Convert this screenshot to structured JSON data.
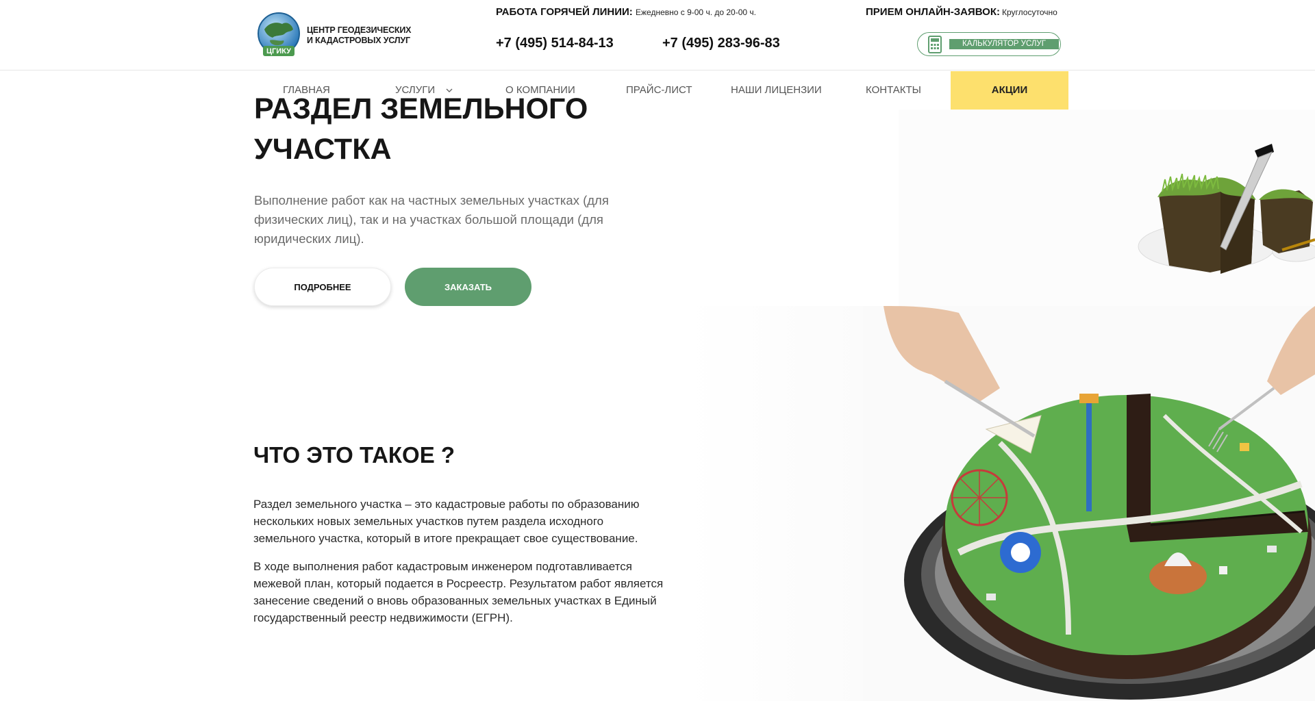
{
  "header": {
    "logo_line1": "ЦЕНТР ГЕОДЕЗИЧЕСКИХ",
    "logo_line2": "И КАДАСТРОВЫХ УСЛУГ",
    "logo_badge": "ЦГИКУ",
    "hotline_label": "РАБОТА ГОРЯЧЕЙ ЛИНИИ:",
    "hotline_hours": "Ежедневно с 9-00 ч. до 20-00 ч.",
    "phone_1": "+7 (495) 514-84-13",
    "phone_2": "+7 (495) 283-96-83",
    "online_label": "ПРИЕМ ОНЛАЙН-ЗАЯВОК:",
    "online_value": "Круглосуточно",
    "calculator_label": "КАЛЬКУЛЯТОР УСЛУГ"
  },
  "nav": {
    "items": [
      {
        "label": "ГЛАВНАЯ"
      },
      {
        "label": "УСЛУГИ"
      },
      {
        "label": "О КОМПАНИИ"
      },
      {
        "label": "ПРАЙС-ЛИСТ"
      },
      {
        "label": "НАШИ ЛИЦЕНЗИИ"
      },
      {
        "label": "КОНТАКТЫ"
      },
      {
        "label": "АКЦИИ"
      }
    ]
  },
  "hero": {
    "title_line1": "РАЗДЕЛ ЗЕМЕЛЬНОГО",
    "title_line2": "УЧАСТКА",
    "description": "Выполнение работ как на частных земельных участках (для физических лиц), так и на участках большой площади (для юридических лиц).",
    "more_button": "ПОДРОБНЕЕ",
    "order_button": "ЗАКАЗАТЬ"
  },
  "about": {
    "title": "ЧТО ЭТО ТАКОЕ ?",
    "paragraph_1": "Раздел земельного участка – это кадастровые работы по образованию нескольких новых земельных участков путем раздела исходного земельного участка, который в итоге прекращает свое существование.",
    "paragraph_2": "В ходе выполнения работ кадастровым инженером подготавливается межевой план, который подается в Росреестр. Результатом работ является занесение сведений о вновь образованных земельных участках в Единый государственный реестр недвижимости (ЕГРН)."
  },
  "colors": {
    "accent_green": "#5f9e6f",
    "promo_yellow": "#fde06d",
    "text_dark": "#161616",
    "text_muted": "#6a6a6a"
  },
  "icons": [
    "globe-logo-icon",
    "calculator-icon",
    "chevron-down-icon",
    "grass-cake-illustration",
    "map-cake-illustration"
  ]
}
